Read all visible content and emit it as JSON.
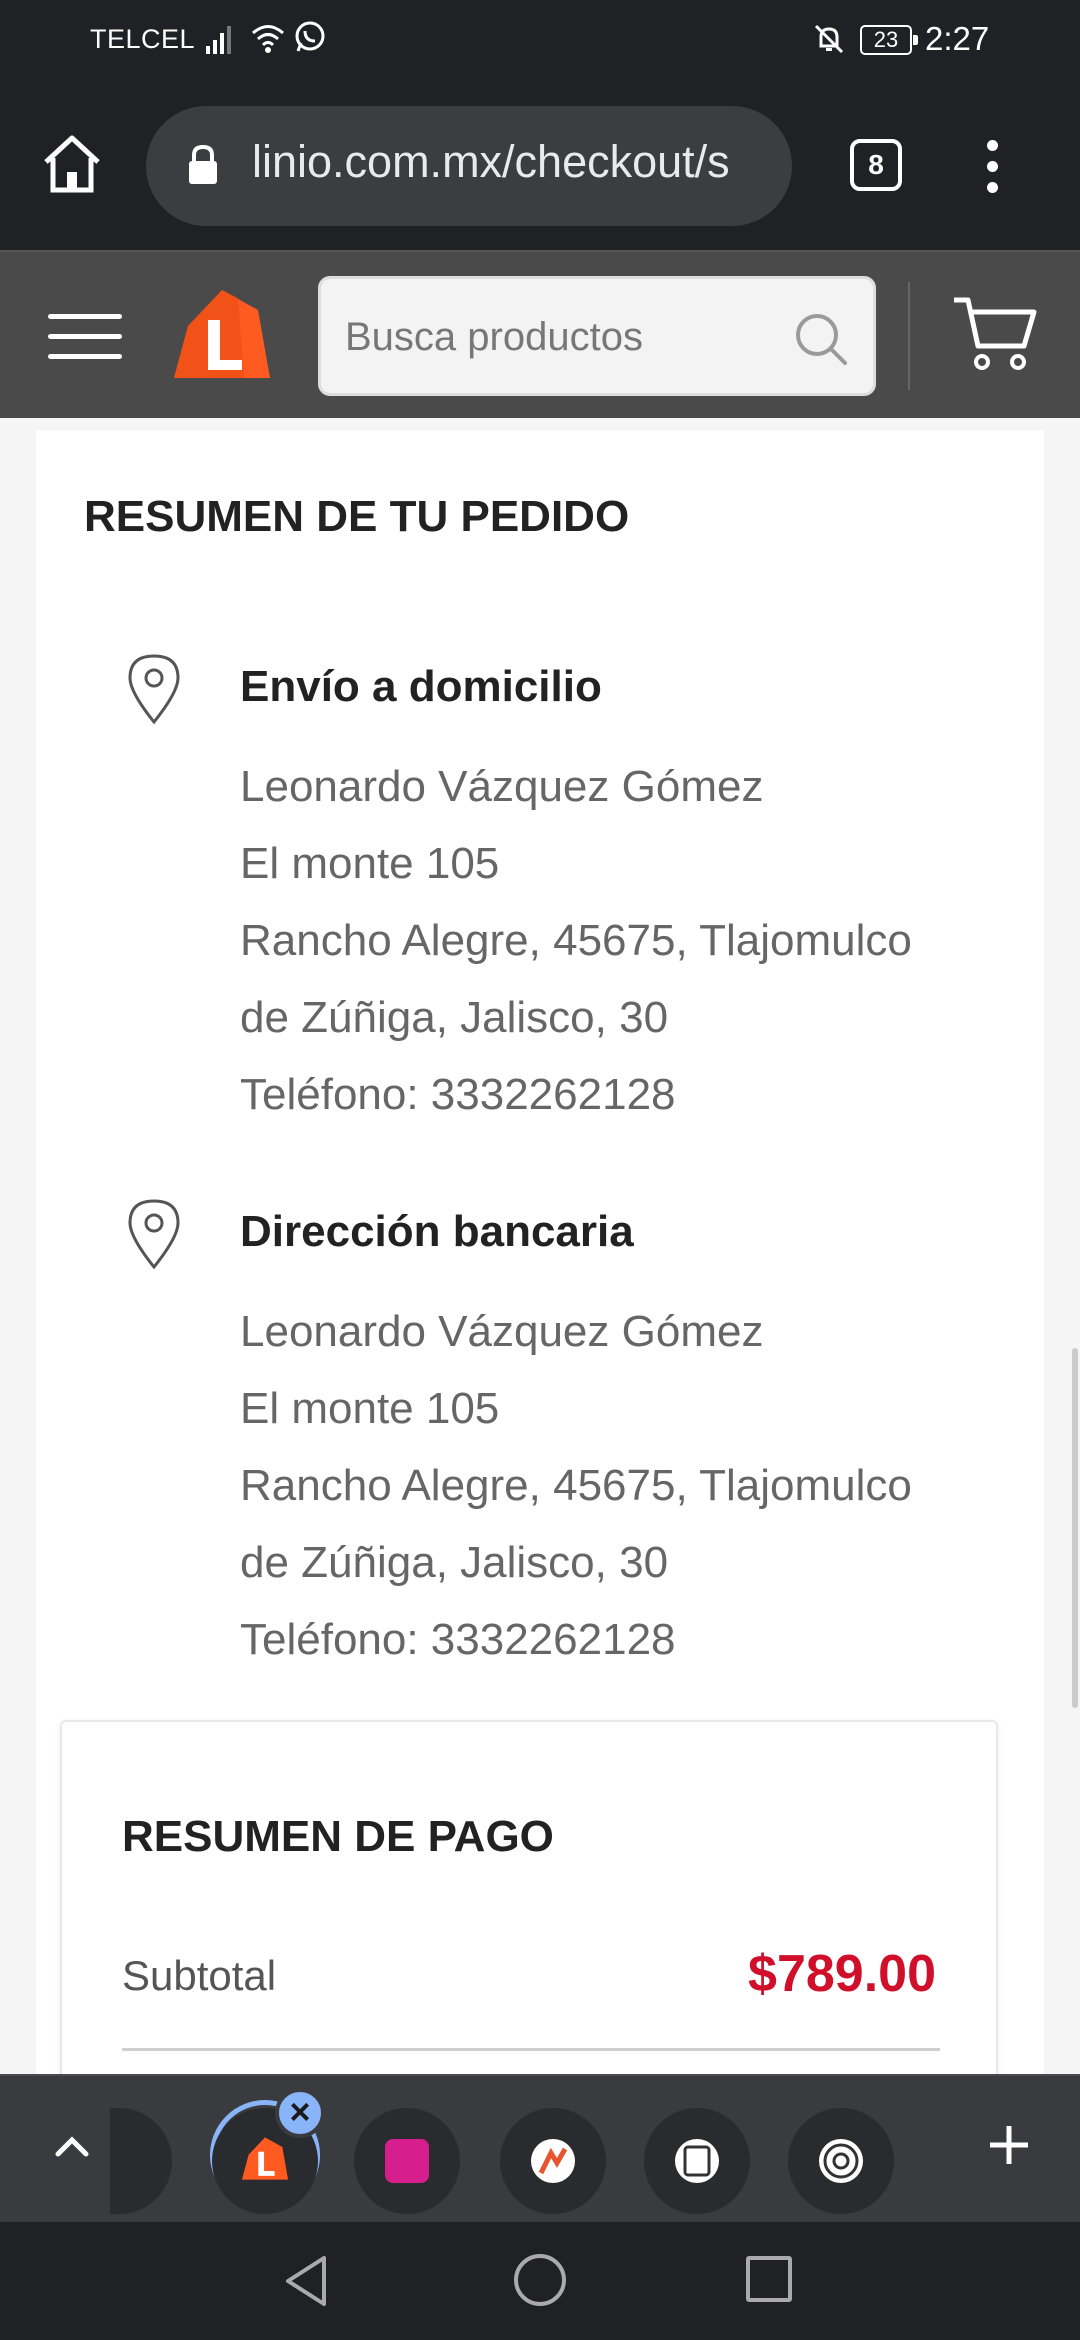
{
  "status_bar": {
    "carrier": "TELCEL",
    "battery": "23",
    "time": "2:27"
  },
  "browser": {
    "url": "linio.com.mx/checkout/s",
    "tab_count": "8"
  },
  "site_header": {
    "search_placeholder": "Busca productos",
    "logo_letter": "L",
    "brand_color": "#ff5a1f"
  },
  "order_summary": {
    "title": "RESUMEN DE TU PEDIDO",
    "shipping": {
      "title": "Envío a domicilio",
      "lines": [
        "Leonardo Vázquez Gómez",
        "El monte 105",
        "Rancho Alegre, 45675, Tlajomulco",
        "de Zúñiga, Jalisco, 30",
        "Teléfono: 3332262128"
      ]
    },
    "billing": {
      "title": "Dirección bancaria",
      "lines": [
        "Leonardo Vázquez Gómez",
        "El monte 105",
        "Rancho Alegre, 45675, Tlajomulco",
        "de Zúñiga, Jalisco, 30",
        "Teléfono: 3332262128"
      ]
    }
  },
  "payment_summary": {
    "title": "RESUMEN DE PAGO",
    "subtotal_label": "Subtotal",
    "subtotal_value": "$789.00",
    "price_color": "#d0102b"
  },
  "dock": {
    "apps": [
      "linio-app",
      "gallery-app",
      "fitness-app",
      "device-app",
      "chrome-app"
    ],
    "active_app": "linio-app",
    "close_label": "×",
    "add_label": "+"
  }
}
